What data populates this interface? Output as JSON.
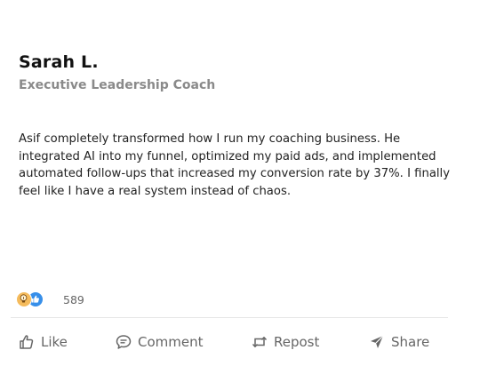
{
  "post": {
    "author_name": "Sarah L.",
    "author_title": "Executive Leadership Coach",
    "body": "Asif completely transformed how I run my coaching business. He integrated AI into my funnel, optimized my paid ads, and implemented automated follow-ups that increased my conversion rate by 37%. I finally feel like I have a real system instead of chaos."
  },
  "reactions": {
    "icons": [
      "insightful-lightbulb-icon",
      "like-thumb-icon"
    ],
    "count": "589",
    "colors": {
      "insightful": "#f5bb5c",
      "like": "#378fe9"
    }
  },
  "actions": {
    "like": "Like",
    "comment": "Comment",
    "repost": "Repost",
    "share": "Share"
  }
}
